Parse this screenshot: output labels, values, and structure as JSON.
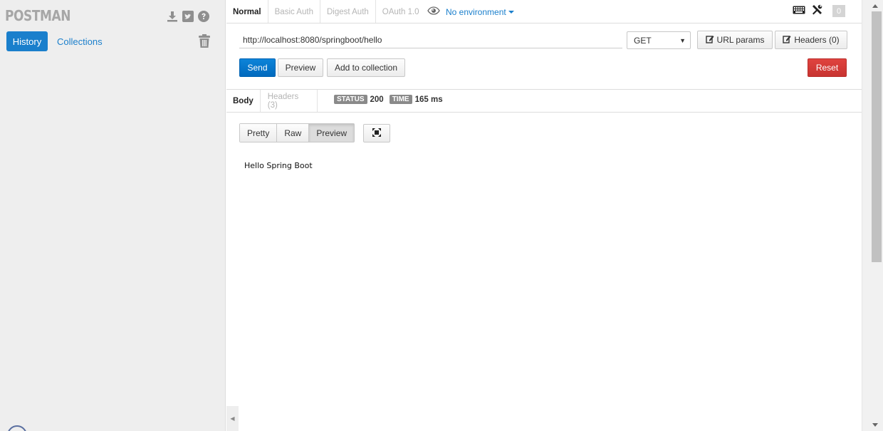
{
  "sidebar": {
    "logo": "POSTMAN",
    "icons": [
      "download-icon",
      "twitter-icon",
      "help-icon"
    ],
    "tabs": {
      "history": "History",
      "collections": "Collections"
    },
    "trash_icon": "trash-icon"
  },
  "request": {
    "auth_tabs": [
      "Normal",
      "Basic Auth",
      "Digest Auth",
      "OAuth 1.0"
    ],
    "environment": "No environment",
    "counter": "0",
    "url": "http://localhost:8080/springboot/hello",
    "method": "GET",
    "url_params_label": "URL params",
    "headers_label": "Headers (0)",
    "send_label": "Send",
    "preview_label": "Preview",
    "add_collection_label": "Add to collection",
    "reset_label": "Reset"
  },
  "response": {
    "tabs": [
      "Body",
      "Headers (3)"
    ],
    "status_label": "STATUS",
    "status_value": "200",
    "time_label": "TIME",
    "time_value": "165 ms",
    "view_modes": [
      "Pretty",
      "Raw",
      "Preview"
    ],
    "active_view": "Preview",
    "body": "Hello Spring Boot"
  },
  "colors": {
    "primary": "#1a7fcc",
    "danger": "#d43f3a",
    "pill": "#8a8a8a"
  }
}
